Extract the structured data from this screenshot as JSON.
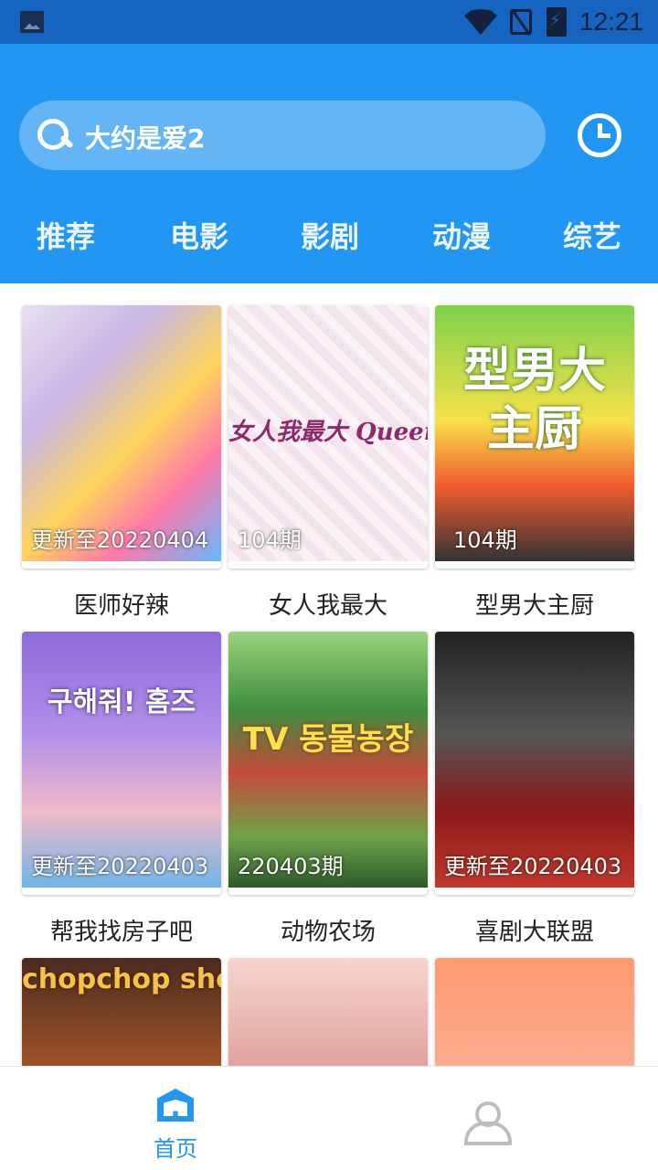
{
  "status_bar": {
    "time": "12:21"
  },
  "search": {
    "query": "大约是爱2"
  },
  "tabs": [
    "推荐",
    "电影",
    "影剧",
    "动漫",
    "综艺"
  ],
  "shows": [
    {
      "title": "医师好辣",
      "badge": "更新至20220404",
      "poster_text": ""
    },
    {
      "title": "女人我最大",
      "badge": "104期",
      "poster_text": "女人我最大 Queen"
    },
    {
      "title": "型男大主厨",
      "badge": "104期",
      "poster_text": "型男大主厨"
    },
    {
      "title": "帮我找房子吧",
      "badge": "更新至20220403",
      "poster_text": "구해줘! 홈즈"
    },
    {
      "title": "动物农场",
      "badge": "220403期",
      "poster_text": "TV 동물농장"
    },
    {
      "title": "喜剧大联盟",
      "badge": "更新至20220403",
      "poster_text": ""
    },
    {
      "title": "",
      "badge": "",
      "poster_text": "chopchop show"
    },
    {
      "title": "",
      "badge": "",
      "poster_text": ""
    },
    {
      "title": "",
      "badge": "",
      "poster_text": ""
    }
  ],
  "bottom_nav": {
    "home_label": "首页"
  },
  "colors": {
    "primary": "#2196f3",
    "status_bar": "#1565c0",
    "search_bg": "#64b5f6"
  },
  "icons": [
    "image-icon",
    "wifi-icon",
    "no-sim-icon",
    "battery-charging-icon",
    "search-icon",
    "history-clock-icon",
    "home-icon",
    "profile-icon"
  ]
}
